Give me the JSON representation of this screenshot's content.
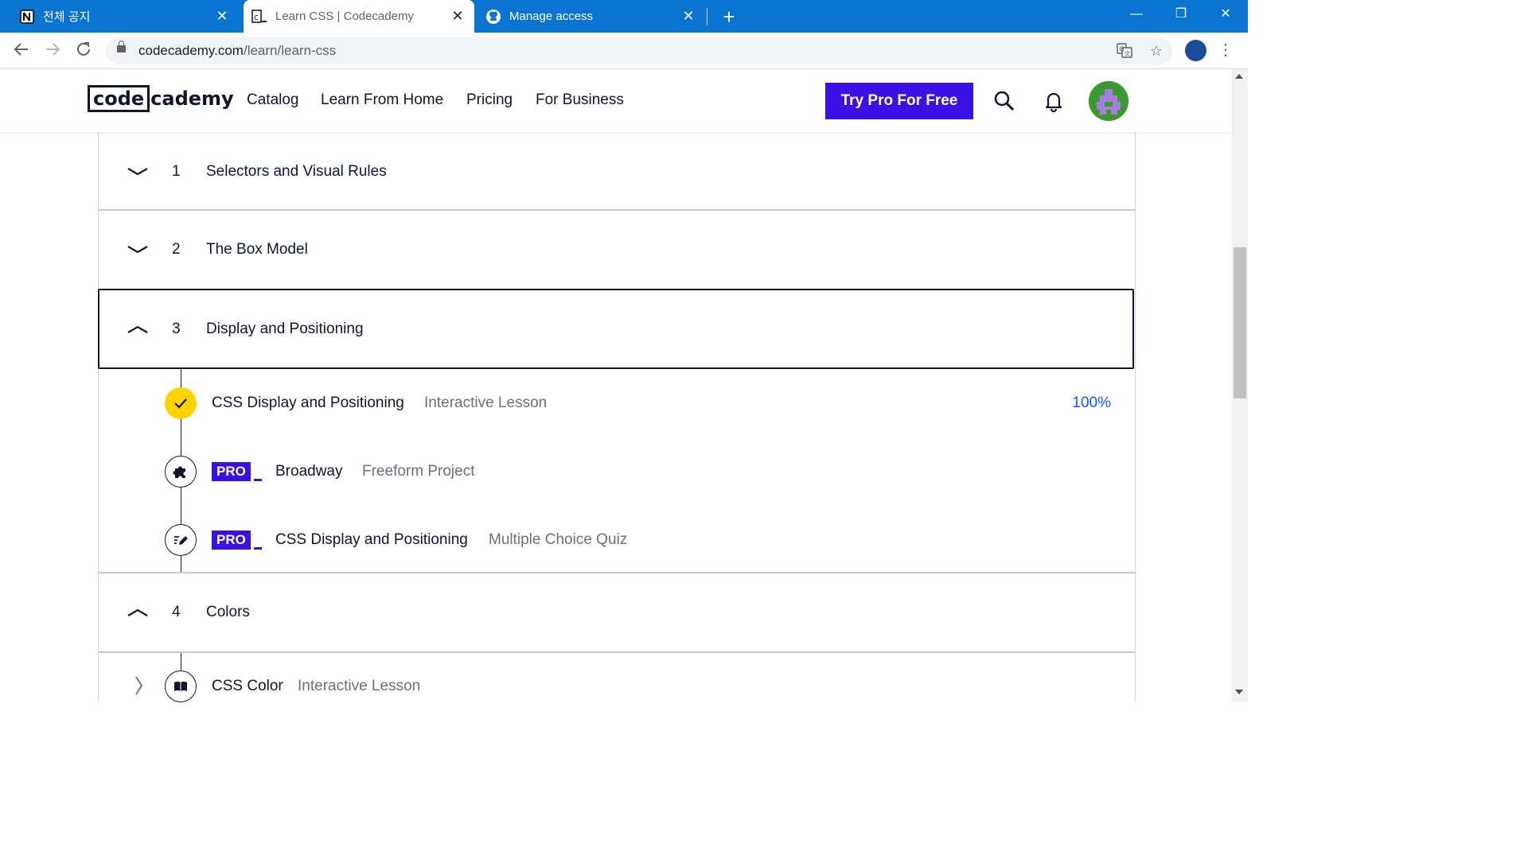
{
  "browser": {
    "tabs": [
      {
        "title": "전체 공지",
        "favicon": "notion-icon",
        "active": false
      },
      {
        "title": "Learn CSS | Codecademy",
        "favicon": "codecademy-icon",
        "active": true
      },
      {
        "title": "Manage access",
        "favicon": "github-icon",
        "active": false
      }
    ],
    "url_host": "codecademy.com",
    "url_path": "/learn/learn-css"
  },
  "header": {
    "logo_left": "code",
    "logo_right": "cademy",
    "nav": [
      "Catalog",
      "Learn From Home",
      "Pricing",
      "For Business"
    ],
    "cta_label": "Try Pro For Free"
  },
  "syllabus": {
    "modules": [
      {
        "number": "1",
        "title": "Selectors and Visual Rules",
        "expanded": false
      },
      {
        "number": "2",
        "title": "The Box Model",
        "expanded": false
      },
      {
        "number": "3",
        "title": "Display and Positioning",
        "expanded": true
      },
      {
        "number": "4",
        "title": "Colors",
        "expanded": true
      }
    ],
    "module3_items": [
      {
        "name": "CSS Display and Positioning",
        "type": "Interactive Lesson",
        "progress": "100%",
        "status": "completed",
        "icon": "checkmark-icon"
      },
      {
        "pro_badge": "PRO",
        "name": "Broadway",
        "type": "Freeform Project",
        "icon": "puzzle-icon"
      },
      {
        "pro_badge": "PRO",
        "name": "CSS Display and Positioning",
        "type": "Multiple Choice Quiz",
        "icon": "pencil-quiz-icon"
      }
    ],
    "module4_items": [
      {
        "name": "CSS Color",
        "type": "Interactive Lesson",
        "icon": "book-icon"
      }
    ]
  },
  "colors": {
    "brand_purple": "#3a10e5",
    "tab_strip_blue": "#0a74d1",
    "complete_yellow": "#ffd300",
    "progress_blue": "#1557ff"
  }
}
